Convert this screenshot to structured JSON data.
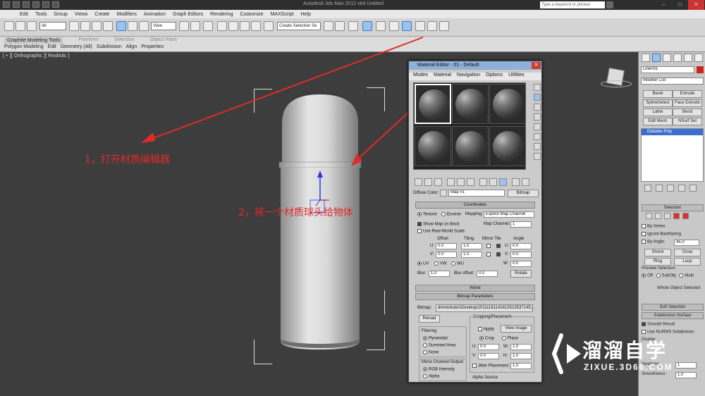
{
  "title_bar": {
    "app_title": "Autodesk 3ds Max 2012 x64    Untitled",
    "search_placeholder": "Type a keyword or phrase"
  },
  "menubar": [
    "Edit",
    "Tools",
    "Group",
    "Views",
    "Create",
    "Modifiers",
    "Animation",
    "Graph Editors",
    "Rendering",
    "Customize",
    "MAXScript",
    "Help"
  ],
  "toolbar": {
    "selection_filter": "All",
    "reference_coord": "View",
    "named_selection": "Create Selection Se"
  },
  "ribbon": {
    "tabs": [
      "Graphite Modeling Tools",
      "Freeform",
      "Selection",
      "Object Paint"
    ],
    "sub": [
      "Polygon Modeling",
      "Edit",
      "Geometry (All)",
      "Subdivision",
      "Align",
      "Properties"
    ]
  },
  "viewport": {
    "label": "[ + ][ Orthographic ][ Realistic ]"
  },
  "annotations": {
    "step1": "1，打开材质编辑器",
    "step2": "2，将一个材质球头给物体"
  },
  "command_panel": {
    "object_name": "Line001",
    "object_color": "#d02020",
    "modifier_list": "Modifier List",
    "buttons": [
      "Bevel",
      "Extrude",
      "SplineSelect",
      "Face Extrude",
      "Lathe",
      "Bend",
      "Edit Mesh",
      "NSurf Sel"
    ],
    "stack_item": "Editable Poly",
    "selection": {
      "header": "Selection",
      "by_vertex": "By Vertex",
      "ignore_backfacing": "Ignore Backfacing",
      "by_angle": "By Angle:",
      "by_angle_value": "45.0",
      "shrink": "Shrink",
      "grow": "Grow",
      "ring": "Ring",
      "loop": "Loop",
      "preview_selection": "Preview Selection",
      "off": "Off",
      "subobj": "SubObj",
      "multi": "Multi",
      "whole_object": "Whole Object Selected"
    },
    "soft_selection": "Soft Selection",
    "subdivision_surface": "Subdivision Surface",
    "smooth_result": "Smooth Result",
    "use_nurms": "Use NURMS Subdivision",
    "display": "Display",
    "iterations_label": "Iterations:",
    "iterations_value": "1",
    "smoothness_label": "Smoothness:",
    "smoothness_value": "1.0"
  },
  "material_editor": {
    "title": "Material Editor - 01 - Default",
    "menu": [
      "Modes",
      "Material",
      "Navigation",
      "Options",
      "Utilities"
    ],
    "diffuse_label": "Diffuse Color:",
    "map_name": "Map #1",
    "map_type": "Bitmap",
    "coordinates": {
      "header": "Coordinates",
      "texture": "Texture",
      "environ": "Environ",
      "mapping_label": "Mapping:",
      "mapping_value": "Explicit Map Channel",
      "show_map_on_back": "Show Map on Back",
      "map_channel_label": "Map Channel:",
      "map_channel_value": "1",
      "real_world": "Use Real-World Scale",
      "offset": "Offset",
      "tiling": "Tiling",
      "mirror_tile": "Mirror Tile",
      "angle": "Angle",
      "u": "U:",
      "v": "V:",
      "w": "W:",
      "u_offset": "0.0",
      "v_offset": "0.0",
      "u_tiling": "1.0",
      "v_tiling": "1.0",
      "u_angle": "0.0",
      "v_angle": "0.0",
      "w_angle": "0.0",
      "uv": "UV",
      "vw": "VW",
      "wu": "WU",
      "blur_label": "Blur:",
      "blur_value": "1.0",
      "blur_offset_label": "Blur offset:",
      "blur_offset_value": "0.0",
      "rotate": "Rotate"
    },
    "noise_header": "Noise",
    "bitmap_params": {
      "header": "Bitmap Parameters",
      "bitmap_label": "Bitmap:",
      "bitmap_path": "dministrator\\Desktop\\20111191141613513537145.jpg",
      "reload": "Reload",
      "cropping": "Cropping/Placement",
      "apply": "Apply",
      "view_image": "View Image",
      "crop": "Crop",
      "place": "Place",
      "filtering": "Filtering",
      "pyramidal": "Pyramidal",
      "summed_area": "Summed Area",
      "none": "None",
      "u_val": "0.0",
      "v_val": "0.0",
      "w_val": "1.0",
      "h_val": "1.0",
      "w_label": "W:",
      "h_label": "H:",
      "jitter": "Jitter Placement:",
      "jitter_val": "1.0",
      "mono_output": "Mono Channel Output:",
      "rgb_intensity": "RGB Intensity",
      "alpha": "Alpha",
      "alpha_source": "Alpha Source"
    }
  },
  "watermark": {
    "brand": "溜溜自学",
    "url": "ZIXUE.3D66.COM"
  }
}
